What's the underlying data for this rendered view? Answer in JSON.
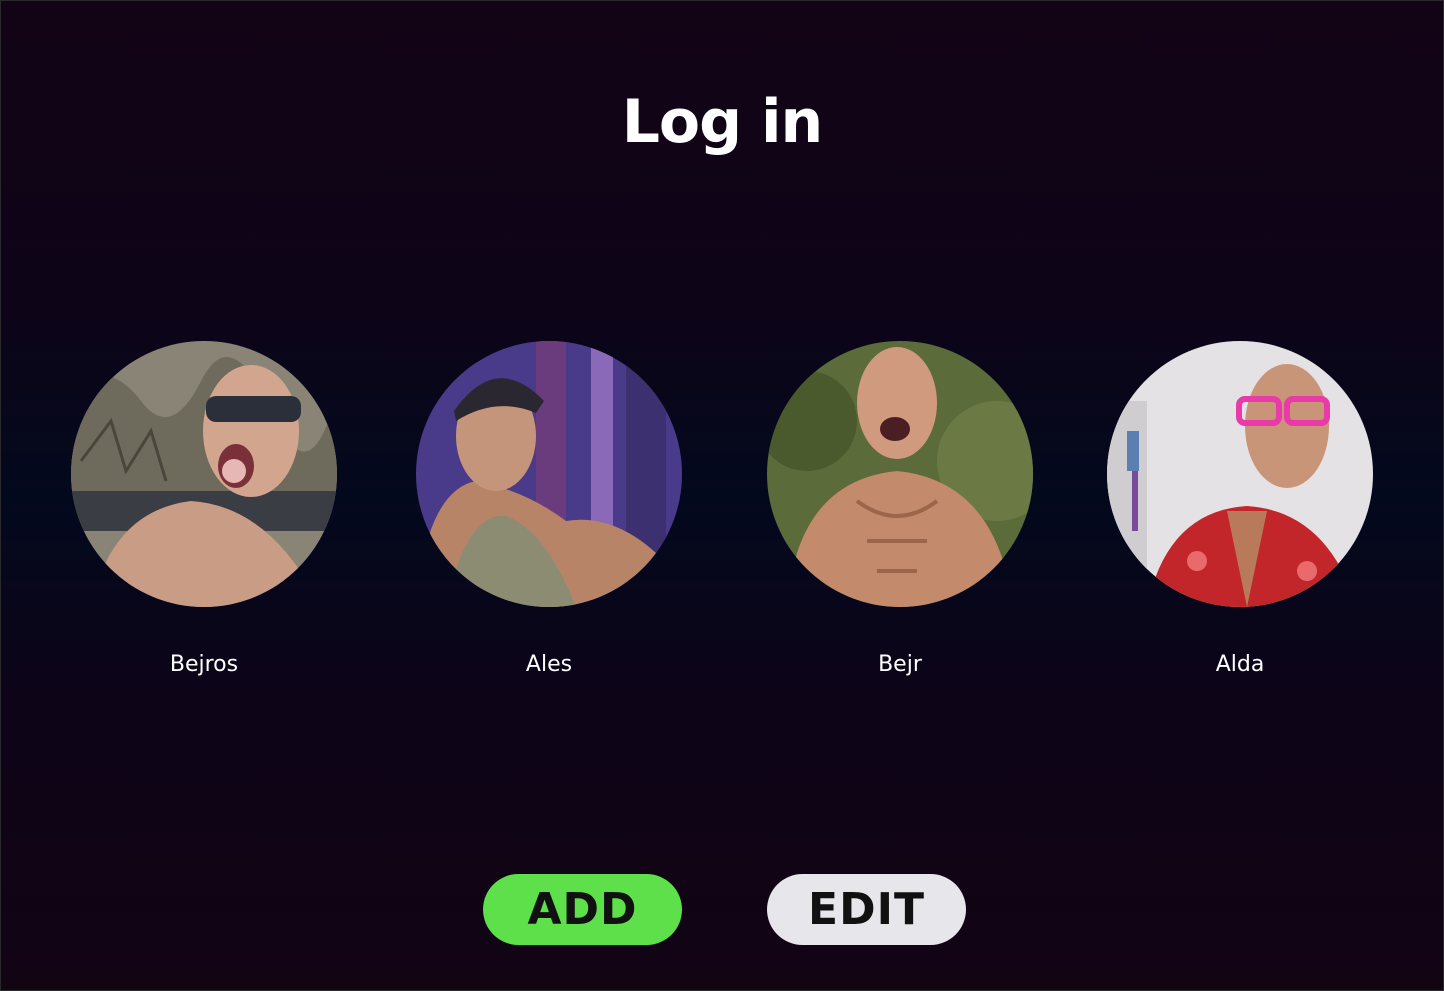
{
  "header": {
    "title": "Log in"
  },
  "profiles": [
    {
      "name": "Bejros",
      "avatar_icon": "person-avatar-sunglasses"
    },
    {
      "name": "Ales",
      "avatar_icon": "person-avatar-cap"
    },
    {
      "name": "Bejr",
      "avatar_icon": "person-avatar-shouting"
    },
    {
      "name": "Alda",
      "avatar_icon": "person-avatar-pink-glasses"
    }
  ],
  "actions": {
    "add_label": "ADD",
    "edit_label": "EDIT"
  },
  "colors": {
    "background": "#0e0418",
    "add_button": "#5ee04a",
    "edit_button": "#e7e6ea",
    "text": "#ffffff"
  }
}
